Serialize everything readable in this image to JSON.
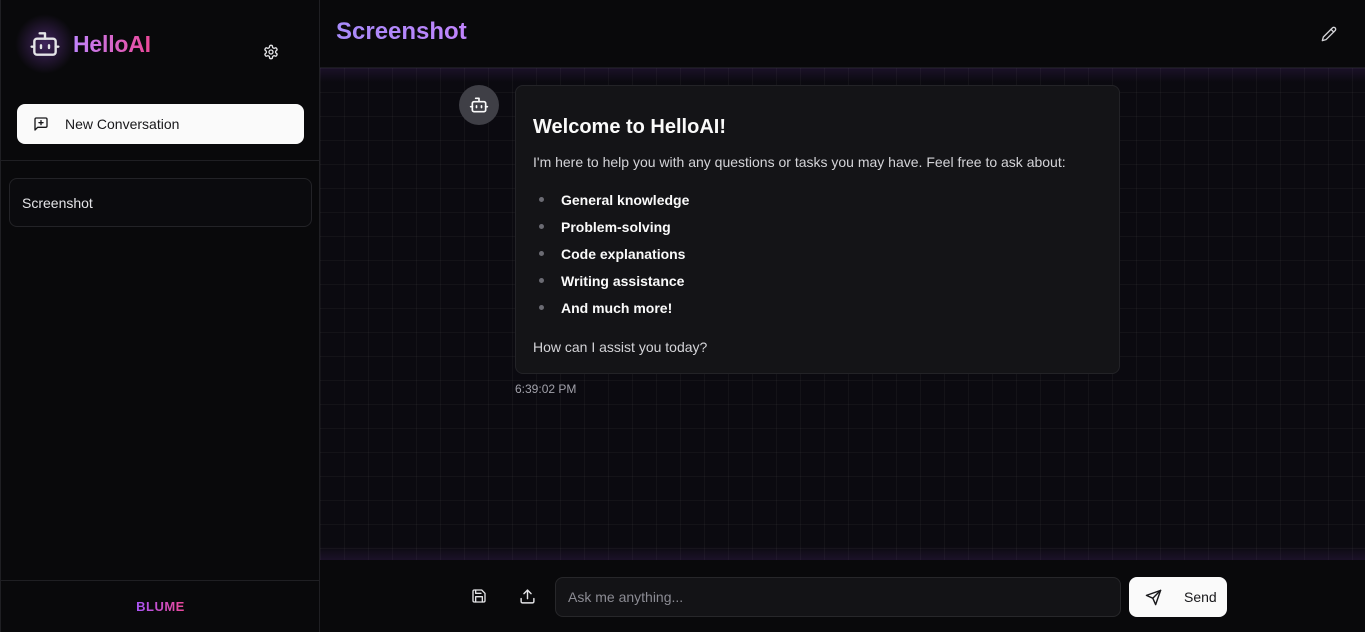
{
  "app": {
    "title": "HelloAI",
    "footer_brand": "BLUME"
  },
  "sidebar": {
    "new_conversation_label": "New Conversation",
    "conversations": [
      {
        "label": "Screenshot"
      }
    ]
  },
  "header": {
    "title": "Screenshot"
  },
  "message": {
    "heading": "Welcome to HelloAI!",
    "intro": "I'm here to help you with any questions or tasks you may have. Feel free to ask about:",
    "topics": [
      "General knowledge",
      "Problem-solving",
      "Code explanations",
      "Writing assistance",
      "And much more!"
    ],
    "outro": "How can I assist you today?",
    "timestamp": "6:39:02 PM"
  },
  "composer": {
    "placeholder": "Ask me anything...",
    "send_label": "Send"
  },
  "icons": {
    "brand": "bot-icon",
    "settings": "gear-icon",
    "new_conversation": "message-plus-icon",
    "edit": "pencil-icon",
    "avatar": "bot-icon",
    "save": "save-icon",
    "upload": "upload-icon",
    "send": "send-icon"
  },
  "colors": {
    "accent_purple": "#a855f7",
    "accent_pink": "#ec4899",
    "background": "#09090b",
    "button_light": "#fafafa"
  }
}
